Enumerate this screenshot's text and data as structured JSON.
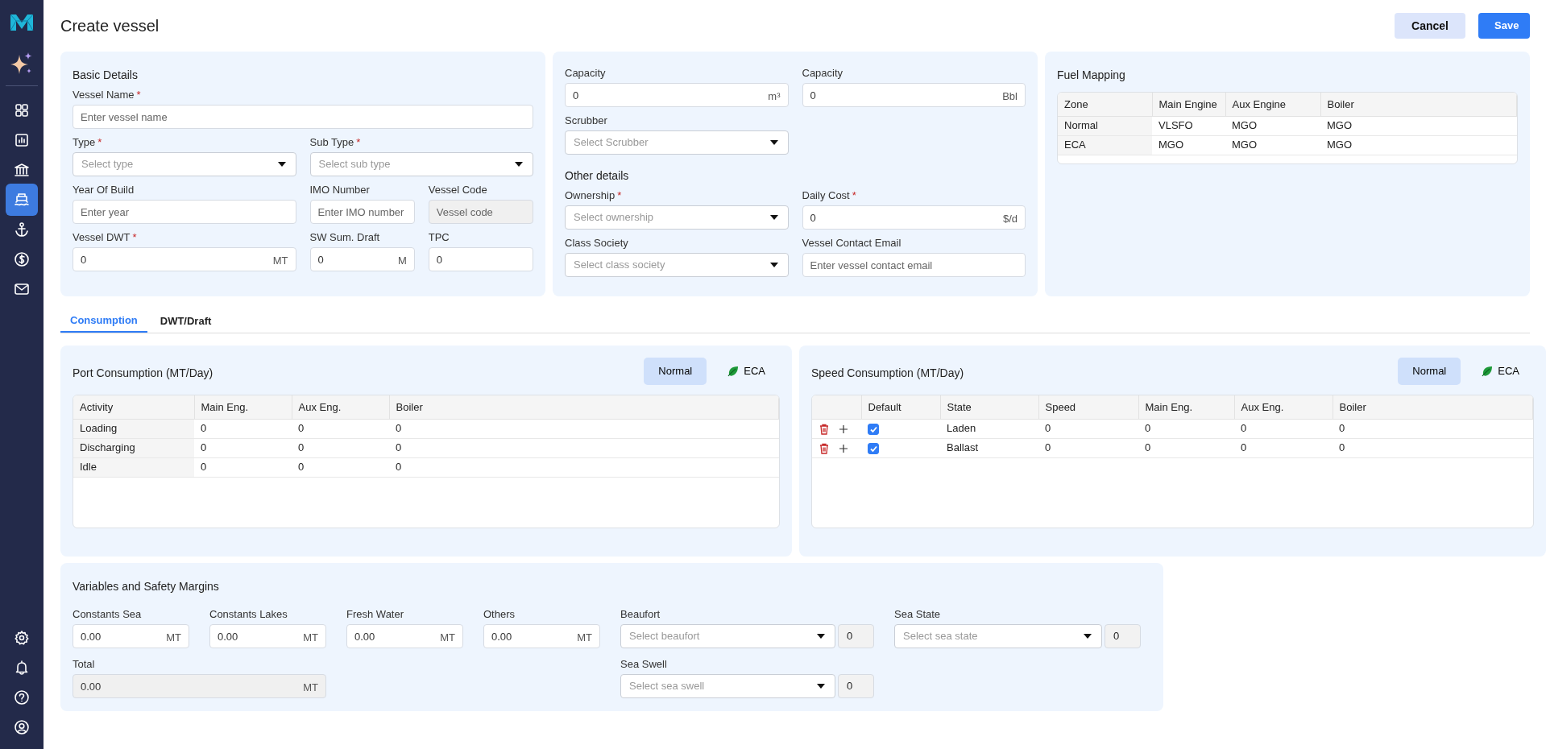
{
  "sidebar": {
    "items": [
      {
        "selected": false
      },
      {
        "selected": false
      },
      {
        "selected": false
      },
      {
        "selected": true
      },
      {
        "selected": false
      },
      {
        "selected": false
      },
      {
        "selected": false
      }
    ]
  },
  "header": {
    "title": "Create vessel",
    "buttons": [
      {
        "label": "Cancel",
        "kind": "secondary"
      },
      {
        "label": "Save",
        "kind": "primary"
      }
    ]
  },
  "cards": [
    {
      "sections": [
        {
          "title": "Basic Details",
          "fields": [
            {
              "label": "Vessel Name",
              "required_mark": "*",
              "kind": "text",
              "placeholder": "Enter vessel name",
              "disabled": false
            },
            {
              "label": "Type",
              "required_mark": "*",
              "kind": "select",
              "placeholder": "Select type",
              "disabled": false
            },
            {
              "label": "Sub Type",
              "required_mark": "*",
              "kind": "select",
              "placeholder": "Select sub type",
              "disabled": false
            },
            {
              "label": "Year Of Build",
              "kind": "text",
              "placeholder": "Enter year",
              "disabled": false
            },
            {
              "label": "IMO Number",
              "kind": "text",
              "placeholder": "Enter IMO number",
              "disabled": false
            },
            {
              "label": "Vessel Code",
              "kind": "text",
              "placeholder": "Vessel code",
              "disabled": true
            },
            {
              "label": "Vessel DWT",
              "required_mark": "*",
              "kind": "text",
              "value": "0",
              "unit": "MT",
              "disabled": false
            },
            {
              "label": "SW Sum. Draft",
              "kind": "text",
              "value": "0",
              "unit": "M",
              "disabled": false
            },
            {
              "label": "TPC",
              "kind": "text",
              "value": "0",
              "disabled": false
            }
          ]
        }
      ]
    },
    {
      "sections": [
        {
          "fields": [
            {
              "label": "Capacity",
              "kind": "text",
              "value": "0",
              "unit": "m³",
              "disabled": false
            },
            {
              "label": "Capacity",
              "kind": "text",
              "value": "0",
              "unit": "Bbl",
              "disabled": false
            },
            {
              "label": "Scrubber",
              "kind": "select",
              "placeholder": "Select Scrubber",
              "disabled": false
            }
          ]
        },
        {
          "title": "Other details",
          "fields": [
            {
              "label": "Ownership",
              "required_mark": "*",
              "kind": "select",
              "placeholder": "Select ownership",
              "disabled": false
            },
            {
              "label": "Daily Cost",
              "required_mark": "*",
              "kind": "text",
              "value": "0",
              "unit": "$/d",
              "disabled": false
            },
            {
              "label": "Class Society",
              "kind": "select",
              "placeholder": "Select class society",
              "disabled": false
            },
            {
              "label": "Vessel Contact Email",
              "kind": "text",
              "placeholder": "Enter vessel contact email",
              "disabled": false
            }
          ]
        }
      ]
    }
  ],
  "fuel_mapping": {
    "title": "Fuel Mapping",
    "columns": [
      "Zone",
      "Main Engine",
      "Aux Engine",
      "Boiler"
    ],
    "rows": [
      [
        "Normal",
        "VLSFO",
        "MGO",
        "MGO"
      ],
      [
        "ECA",
        "MGO",
        "MGO",
        "MGO"
      ]
    ]
  },
  "tabs": [
    {
      "label": "Consumption",
      "selected": true
    },
    {
      "label": "DWT/Draft",
      "selected": false
    }
  ],
  "port_consumption": {
    "title": "Port Consumption (MT/Day)",
    "modes": [
      {
        "label": "Normal",
        "selected": true
      },
      {
        "label": "ECA",
        "selected": false
      }
    ],
    "columns": [
      "Activity",
      "Main Eng.",
      "Aux Eng.",
      "Boiler"
    ],
    "rows": [
      [
        "Loading",
        "0",
        "0",
        "0"
      ],
      [
        "Discharging",
        "0",
        "0",
        "0"
      ],
      [
        "Idle",
        "0",
        "0",
        "0"
      ]
    ]
  },
  "speed_consumption": {
    "title": "Speed Consumption (MT/Day)",
    "modes": [
      {
        "label": "Normal",
        "selected": true
      },
      {
        "label": "ECA",
        "selected": false
      }
    ],
    "columns": [
      "",
      "Default",
      "State",
      "Speed",
      "Main Eng.",
      "Aux Eng.",
      "Boiler"
    ],
    "rows": [
      {
        "default": true,
        "cells": [
          "",
          "",
          "Laden",
          "0",
          "0",
          "0",
          "0"
        ]
      },
      {
        "default": true,
        "cells": [
          "",
          "",
          "Ballast",
          "0",
          "0",
          "0",
          "0"
        ]
      }
    ]
  },
  "variables": {
    "title": "Variables and Safety Margins",
    "fields": [
      {
        "label": "Constants Sea",
        "kind": "text",
        "value": "0.00",
        "unit": "MT",
        "disabled": false
      },
      {
        "label": "Constants Lakes",
        "kind": "text",
        "value": "0.00",
        "unit": "MT",
        "disabled": false
      },
      {
        "label": "Fresh Water",
        "kind": "text",
        "value": "0.00",
        "unit": "MT",
        "disabled": false
      },
      {
        "label": "Others",
        "kind": "text",
        "value": "0.00",
        "unit": "MT",
        "disabled": false
      },
      {
        "label": "Beaufort",
        "kind": "select_value",
        "placeholder": "Select beaufort",
        "value": "0",
        "disabled": false
      },
      {
        "label": "Sea State",
        "kind": "select_value",
        "placeholder": "Select sea state",
        "value": "0",
        "disabled": false
      },
      {
        "label": "Total",
        "kind": "text",
        "value": "0.00",
        "unit": "MT",
        "disabled": true
      },
      {
        "label": "Sea Swell",
        "kind": "select_value",
        "placeholder": "Select sea swell",
        "value": "0",
        "disabled": false
      }
    ]
  }
}
